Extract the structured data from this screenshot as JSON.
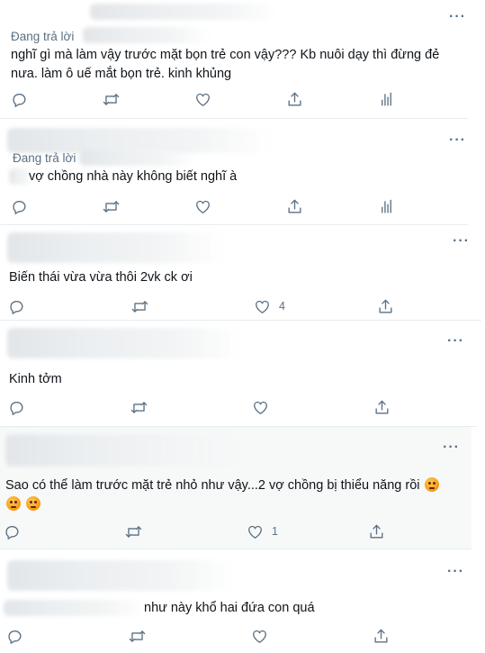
{
  "replies": [
    {
      "replying_label": "Đang trả lời",
      "text": "nghĩ gì mà làm vậy trước mặt bọn trẻ con vậy??? Kb nuôi dạy thì đừng đẻ nưa. làm ô uế mắt bọn trẻ. kinh khủng",
      "like_count": ""
    },
    {
      "replying_label": "Đang trả lời",
      "text": "vợ chồng nhà này không biết nghĩ à",
      "like_count": ""
    },
    {
      "text": "Biến thái vừa vừa thôi 2vk ck ơi",
      "like_count": "4"
    },
    {
      "text": "Kinh tởm",
      "like_count": ""
    },
    {
      "text": "Sao có thể làm trước mặt trẻ nhỏ như vậy...2 vợ chồng bị thiểu năng rồi",
      "emojis": [
        "angry-face-emoji",
        "angry-face-emoji",
        "angry-face-emoji"
      ],
      "like_count": "1"
    },
    {
      "text": "như này khổ hai đứa con quá",
      "like_count": ""
    }
  ],
  "icons": {
    "more": "more-horizontal-icon",
    "reply": "reply-icon",
    "retweet": "retweet-icon",
    "like": "heart-icon",
    "share": "share-icon",
    "analytics": "analytics-icon"
  },
  "colors": {
    "text": "#0f1419",
    "secondary": "#5b7083",
    "border": "#e6ecf0",
    "highlight": "#f7f9f9"
  }
}
